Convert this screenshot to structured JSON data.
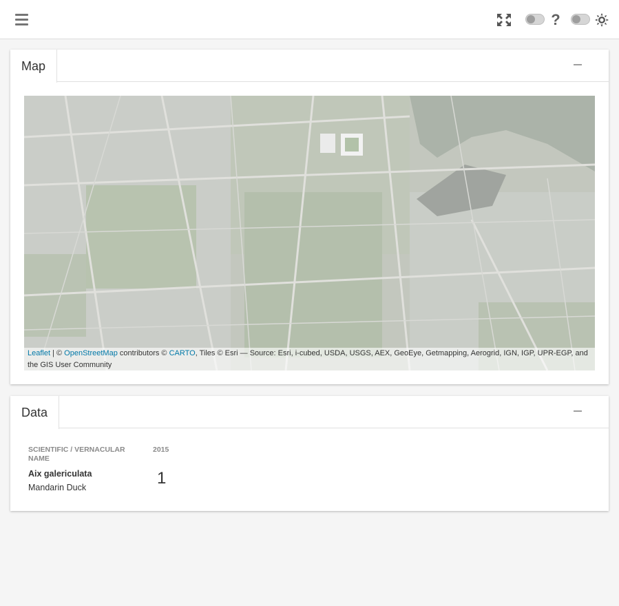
{
  "header": {
    "menu_icon": "hamburger-menu-icon",
    "fullscreen_icon": "expand-arrows-icon",
    "help_icon": "question-mark-icon",
    "theme_icon": "sun-icon",
    "help_glyph": "?"
  },
  "map_card": {
    "title": "Map",
    "attribution": {
      "leaflet": "Leaflet",
      "sep1": " | © ",
      "osm": "OpenStreetMap",
      "sep2": " contributors © ",
      "carto": "CARTO",
      "rest": ", Tiles © Esri — Source: Esri, i-cubed, USDA, USGS, AEX, GeoEye, Getmapping, Aerogrid, IGN, IGP, UPR-EGP, and the GIS User Community"
    }
  },
  "data_card": {
    "title": "Data",
    "columns": {
      "name": "SCIENTIFIC / VERNACULAR NAME",
      "year": "2015"
    },
    "rows": [
      {
        "scientific": "Aix galericulata",
        "vernacular": "Mandarin Duck",
        "count": "1"
      }
    ]
  },
  "colors": {
    "accent_link": "#0078a8",
    "background": "#f5f5f5",
    "card": "#ffffff"
  }
}
